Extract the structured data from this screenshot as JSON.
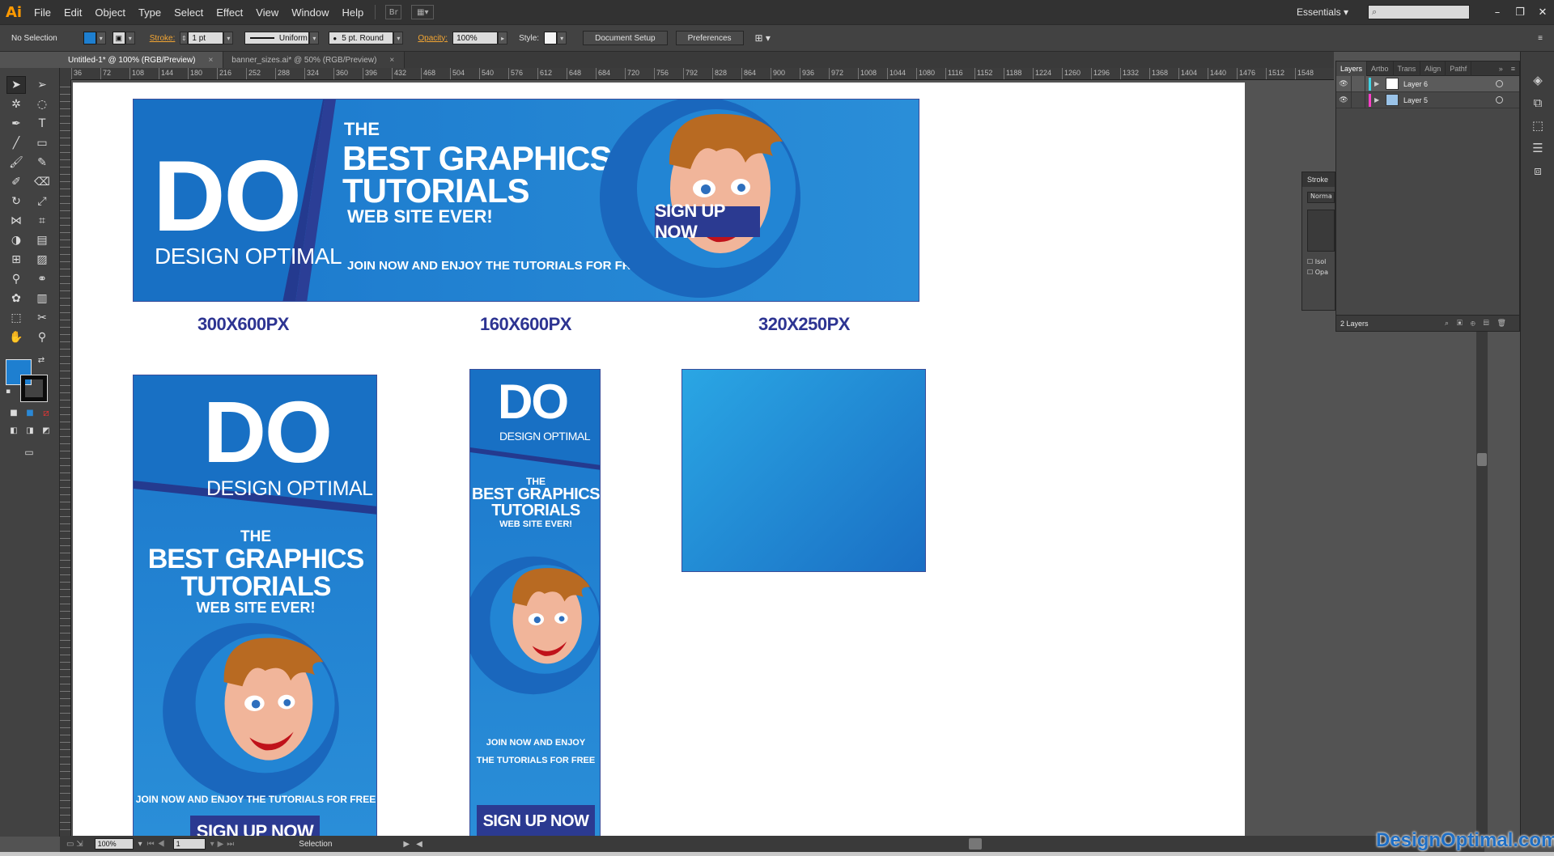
{
  "app": {
    "logo": "Ai"
  },
  "menu": [
    "File",
    "Edit",
    "Object",
    "Type",
    "Select",
    "Effect",
    "View",
    "Window",
    "Help"
  ],
  "topright": {
    "workspace": "Essentials",
    "search_placeholder": ""
  },
  "control": {
    "selection": "No Selection",
    "stroke_label": "Stroke:",
    "stroke_weight": "1 pt",
    "profile": "Uniform",
    "brush": "5 pt. Round",
    "opacity_label": "Opacity:",
    "opacity": "100%",
    "style_label": "Style:",
    "document_setup": "Document Setup",
    "preferences": "Preferences"
  },
  "tabs": [
    {
      "label": "Untitled-1* @ 100% (RGB/Preview)",
      "close": "×"
    },
    {
      "label": "banner_sizes.ai* @ 50% (RGB/Preview)",
      "close": "×"
    }
  ],
  "ruler": [
    "36",
    "72",
    "108",
    "144",
    "180",
    "216",
    "252",
    "288",
    "324",
    "360",
    "396",
    "432",
    "468",
    "504",
    "540",
    "576",
    "612",
    "648",
    "684",
    "720",
    "756",
    "792",
    "828",
    "864",
    "900",
    "936",
    "972",
    "1008",
    "1044",
    "1080",
    "1116",
    "1152",
    "1188",
    "1224",
    "1260",
    "1296",
    "1332",
    "1368",
    "1404",
    "1440",
    "1476",
    "1512",
    "1548"
  ],
  "banners": {
    "do": "DO",
    "brand": "DESIGN OPTIMAL",
    "the": "THE",
    "headline1": "BEST GRAPHICS",
    "headline2": "TUTORIALS",
    "tagline": "WEB SITE EVER!",
    "join": "JOIN NOW AND ENJOY THE TUTORIALS FOR FREE",
    "join_a": "JOIN NOW AND ENJOY",
    "join_b": "THE TUTORIALS FOR FREE",
    "cta": "SIGN UP NOW"
  },
  "size_labels": {
    "a": "300X600PX",
    "b": "160X600PX",
    "c": "320X250PX"
  },
  "layers": {
    "tabs": [
      "Layers",
      "Artbo",
      "Trans",
      "Align",
      "Pathf"
    ],
    "rows": [
      {
        "name": "Layer 6",
        "color": "#3fd5e6",
        "selected": true
      },
      {
        "name": "Layer 5",
        "color": "#ff3ec8",
        "selected": false
      }
    ],
    "count": "2 Layers"
  },
  "stroke_panel": {
    "title": "Stroke",
    "mode": "Norma",
    "isolate": "Isol",
    "opacity": "Opa"
  },
  "status": {
    "zoom": "100%",
    "page": "1",
    "tool": "Selection"
  },
  "watermark": "DesignOptimal.com"
}
